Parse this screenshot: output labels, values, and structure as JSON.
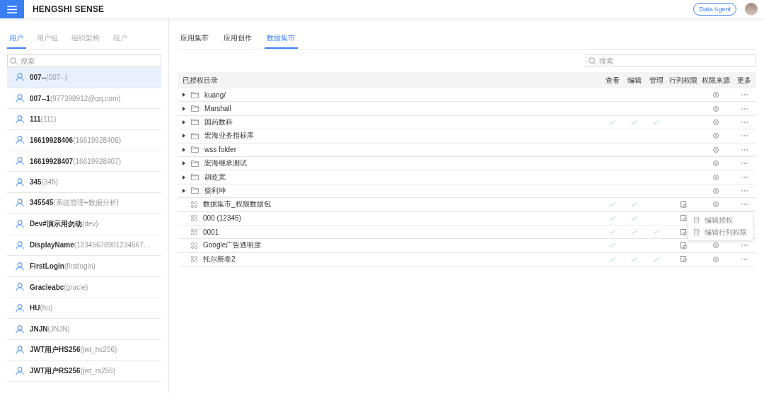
{
  "header": {
    "title": "HENGSHI SENSE",
    "agent_button": "Data Agent"
  },
  "left_tabs": [
    {
      "label": "用户",
      "selected": true
    },
    {
      "label": "用户组",
      "selected": false
    },
    {
      "label": "组织架构",
      "selected": false
    },
    {
      "label": "租户",
      "selected": false
    }
  ],
  "user_search": {
    "placeholder": "搜索"
  },
  "users": [
    {
      "name": "007--",
      "id": "(007--)",
      "selected": true
    },
    {
      "name": "007--1",
      "id": "(977398912@qq.com)",
      "selected": false
    },
    {
      "name": "111",
      "id": "(111)",
      "selected": false
    },
    {
      "name": "16619928406",
      "id": "(16619928406)",
      "selected": false
    },
    {
      "name": "16619928407",
      "id": "(16619928407)",
      "selected": false
    },
    {
      "name": "345",
      "id": "(345)",
      "selected": false
    },
    {
      "name": "345545",
      "id": "(系统管理+数据分析)",
      "selected": false
    },
    {
      "name": "Dev#演示用勿动",
      "id": "(dev)",
      "selected": false
    },
    {
      "name": "DisplayName",
      "id": "(12345678901234567...",
      "selected": false
    },
    {
      "name": "FirstLogin",
      "id": "(firstlogin)",
      "selected": false
    },
    {
      "name": "Gracieabc",
      "id": "(gracie)",
      "selected": false
    },
    {
      "name": "HU",
      "id": "(hu)",
      "selected": false
    },
    {
      "name": "JNJN",
      "id": "(JNJN)",
      "selected": false
    },
    {
      "name": "JWT用户HS256",
      "id": "(jwt_hs256)",
      "selected": false
    },
    {
      "name": "JWT用户RS256",
      "id": "(jwt_rs256)",
      "selected": false
    }
  ],
  "right_tabs": [
    {
      "label": "应用集市",
      "selected": false
    },
    {
      "label": "应用创作",
      "selected": false
    },
    {
      "label": "数据集市",
      "selected": true
    }
  ],
  "table_search": {
    "placeholder": "搜索"
  },
  "table": {
    "columns": [
      "已授权目录",
      "查看",
      "编辑",
      "管理",
      "行列权限",
      "权限来源",
      "更多"
    ],
    "rows": [
      {
        "kind": "folder",
        "name": "kuang/",
        "view": false,
        "edit": false,
        "manage": false,
        "row_col": false,
        "menu_open": false
      },
      {
        "kind": "folder",
        "name": "Marshall",
        "view": false,
        "edit": false,
        "manage": false,
        "row_col": false,
        "menu_open": false
      },
      {
        "kind": "folder",
        "name": "国药数科",
        "view": true,
        "edit": true,
        "manage": true,
        "row_col": false,
        "menu_open": false
      },
      {
        "kind": "folder",
        "name": "宏海业务指标库",
        "view": false,
        "edit": false,
        "manage": false,
        "row_col": false,
        "menu_open": false
      },
      {
        "kind": "folder",
        "name": "wss folder",
        "view": false,
        "edit": false,
        "manage": false,
        "row_col": false,
        "menu_open": false
      },
      {
        "kind": "folder",
        "name": "宏海继承测试",
        "view": false,
        "edit": false,
        "manage": false,
        "row_col": false,
        "menu_open": false
      },
      {
        "kind": "folder",
        "name": "胡屹宽",
        "view": false,
        "edit": false,
        "manage": false,
        "row_col": false,
        "menu_open": false
      },
      {
        "kind": "folder",
        "name": "柴利坤",
        "view": false,
        "edit": false,
        "manage": false,
        "row_col": false,
        "menu_open": false
      },
      {
        "kind": "package",
        "name": "数据集市_权限数据包",
        "view": true,
        "edit": true,
        "manage": false,
        "row_col": true,
        "menu_open": true
      },
      {
        "kind": "package",
        "name": "000 (12345)",
        "view": true,
        "edit": true,
        "manage": false,
        "row_col": true,
        "menu_open": false
      },
      {
        "kind": "package",
        "name": "0001",
        "view": true,
        "edit": true,
        "manage": true,
        "row_col": true,
        "menu_open": false
      },
      {
        "kind": "package",
        "name": "Google广告透明度",
        "view": true,
        "edit": false,
        "manage": false,
        "row_col": true,
        "menu_open": false
      },
      {
        "kind": "package",
        "name": "托尔斯泰2",
        "view": true,
        "edit": true,
        "manage": true,
        "row_col": true,
        "menu_open": false
      }
    ]
  },
  "more_menu": [
    "编辑授权",
    "编辑行列权限"
  ]
}
